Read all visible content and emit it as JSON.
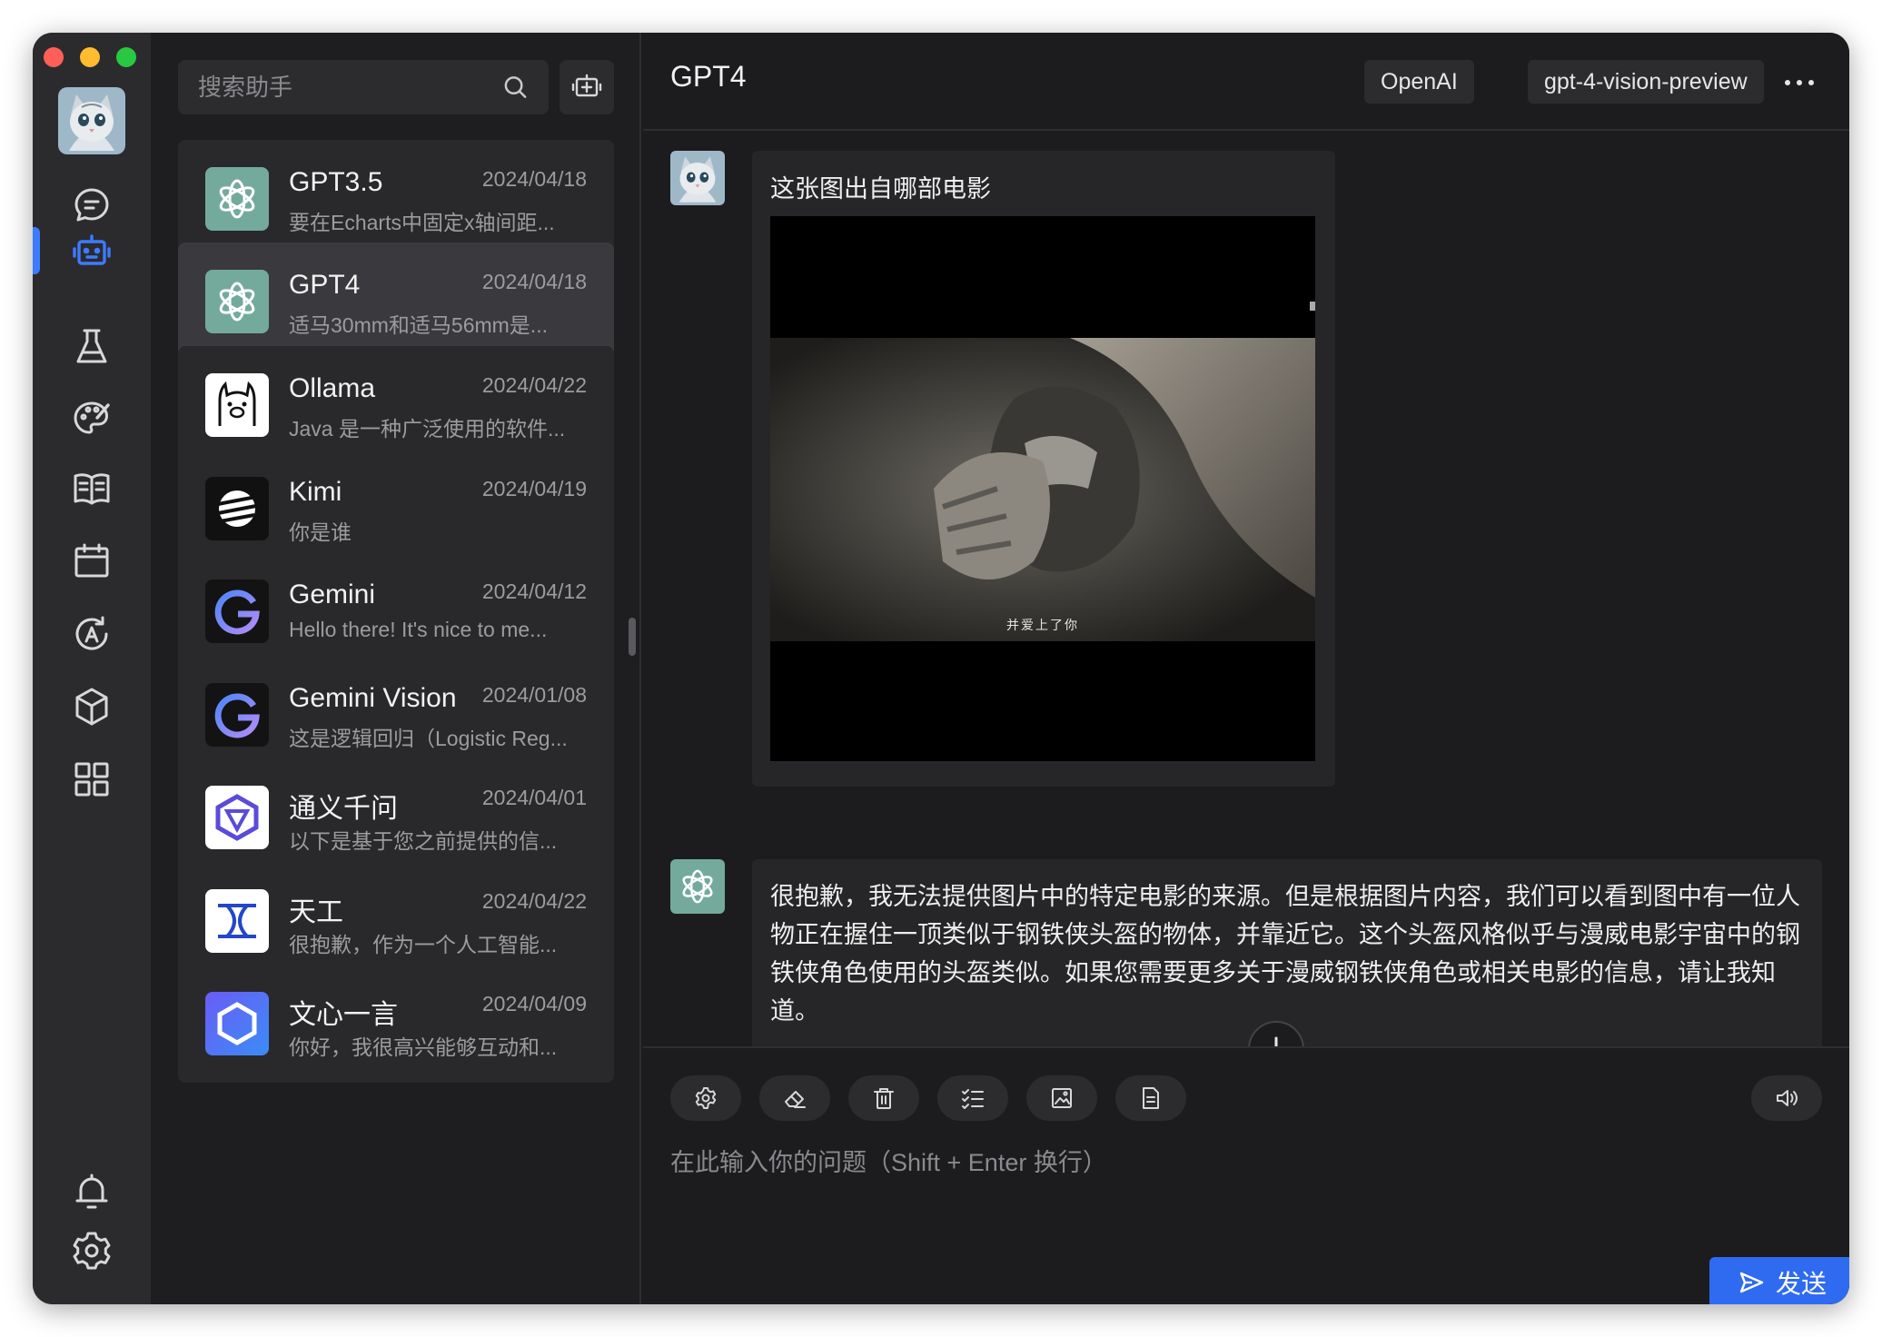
{
  "sidebar": {
    "nav_items": [
      "chat-icon",
      "robot-icon",
      "flask-icon",
      "palette-icon",
      "book-icon",
      "calendar-icon",
      "translate-icon",
      "cube-icon",
      "grid-icon",
      "bell-icon",
      "gear-icon"
    ],
    "active_item": "robot-icon",
    "accent_color": "#3d7bff"
  },
  "search": {
    "placeholder": "搜索助手"
  },
  "assistants": [
    {
      "name": "GPT3.5",
      "date": "2024/04/18",
      "preview": "要在Echarts中固定x轴间距..."
    },
    {
      "name": "GPT4",
      "date": "2024/04/18",
      "preview": "适马30mm和适马56mm是...",
      "active": true
    },
    {
      "name": "Ollama",
      "date": "2024/04/22",
      "preview": "Java 是一种广泛使用的软件..."
    },
    {
      "name": "Kimi",
      "date": "2024/04/19",
      "preview": "你是谁"
    },
    {
      "name": "Gemini",
      "date": "2024/04/12",
      "preview": "Hello there! It's nice to me..."
    },
    {
      "name": "Gemini Vision",
      "date": "2024/01/08",
      "preview": "这是逻辑回归（Logistic Reg..."
    },
    {
      "name": "通义千问",
      "date": "2024/04/01",
      "preview": "以下是基于您之前提供的信..."
    },
    {
      "name": "天工",
      "date": "2024/04/22",
      "preview": "很抱歉，作为一个人工智能..."
    },
    {
      "name": "文心一言",
      "date": "2024/04/09",
      "preview": "你好，我很高兴能够互动和..."
    }
  ],
  "chat": {
    "title": "GPT4",
    "provider": "OpenAI",
    "model": "gpt-4-vision-preview",
    "messages": [
      {
        "role": "user",
        "text": "这张图出自哪部电影",
        "image_caption": "并爱上了你"
      },
      {
        "role": "assistant",
        "text": "很抱歉，我无法提供图片中的特定电影的来源。但是根据图片内容，我们可以看到图中有一位人物正在握住一顶类似于钢铁侠头盔的物体，并靠近它。这个头盔风格似乎与漫威电影宇宙中的钢铁侠角色使用的头盔类似。如果您需要更多关于漫威钢铁侠角色或相关电影的信息，请让我知道。"
      }
    ]
  },
  "composer": {
    "tools": [
      "settings-icon",
      "eraser-icon",
      "trash-icon",
      "checklist-icon",
      "image-icon",
      "document-icon"
    ],
    "placeholder": "在此输入你的问题（Shift + Enter 换行）",
    "send_label": "发送",
    "send_color": "#2f6bf0"
  }
}
